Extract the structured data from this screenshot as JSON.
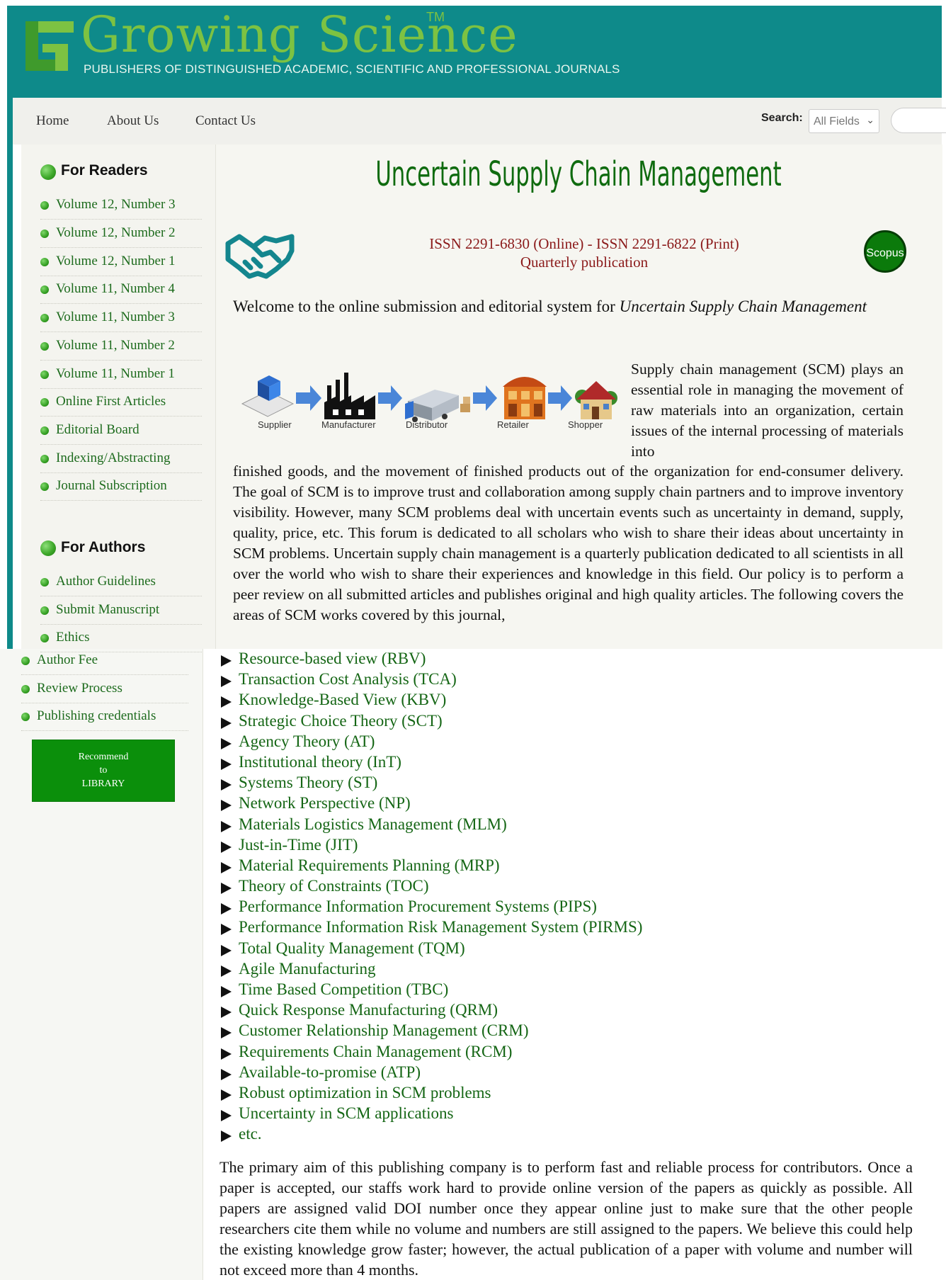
{
  "header": {
    "brand": "Growing Science",
    "trademark": "TM",
    "tagline": "PUBLISHERS OF DISTINGUISHED ACADEMIC, SCIENTIFIC AND PROFESSIONAL JOURNALS",
    "colors": {
      "header_bg": "#0e8a8a",
      "brand_green": "#7dc242"
    }
  },
  "nav": {
    "links": [
      "Home",
      "About Us",
      "Contact Us"
    ],
    "search_label": "Search:",
    "search_scope": "All Fields",
    "search_placeholder": ""
  },
  "sidebar": {
    "readers_heading": "For Readers",
    "readers": [
      "Volume 12, Number 3",
      "Volume 12, Number 2",
      "Volume 12, Number 1",
      "Volume 11, Number 4",
      "Volume 11, Number 3",
      "Volume 11, Number 2",
      "Volume 11, Number 1",
      "Online First Articles",
      "Editorial Board",
      "Indexing/Abstracting",
      "Journal Subscription"
    ],
    "authors_heading": "For Authors",
    "authors": [
      "Author Guidelines",
      "Submit Manuscript",
      "Ethics",
      "Author Fee",
      "Review Process",
      "Publishing credentials"
    ],
    "library_button": [
      "Recommend",
      "to",
      "LIBRARY"
    ]
  },
  "main": {
    "title": "Uncertain Supply Chain Management",
    "issn": "ISSN 2291-6830 (Online) - ISSN 2291-6822 (Print)",
    "frequency": "Quarterly publication",
    "scopus_badge": "Scopus",
    "welcome_prefix": "Welcome to the online submission and editorial system for ",
    "welcome_journal": "Uncertain Supply Chain Management",
    "chain_labels": [
      "Supplier",
      "Manufacturer",
      "Distributor",
      "Retailer",
      "Shopper"
    ],
    "intro_part1": "Supply chain management (SCM) plays an essential role in managing the movement of raw materials into an organization, certain issues of the internal processing of materials into",
    "intro_part2": "finished goods, and the movement of finished products out of the organization for end-consumer delivery. The goal of SCM is to improve trust and collaboration among supply chain partners and to improve inventory visibility. However, many SCM problems deal with uncertain events such as uncertainty in demand, supply, quality, price, etc. This forum is dedicated to all scholars who wish to share their ideas about uncertainty in SCM problems. Uncertain supply chain management is a quarterly publication dedicated to all scientists in all over the world who wish to share their experiences and knowledge in this field. Our policy is to perform a peer review on all submitted articles and publishes original and high quality articles. The following covers the areas of SCM works covered by this journal,",
    "topics": [
      "Resource-based view (RBV)",
      "Transaction Cost Analysis (TCA)",
      "Knowledge-Based View (KBV)",
      "Strategic Choice Theory (SCT)",
      "Agency Theory (AT)",
      "Institutional theory (InT)",
      "Systems Theory (ST)",
      "Network Perspective (NP)",
      "Materials Logistics Management (MLM)",
      "Just-in-Time (JIT)",
      "Material Requirements Planning (MRP)",
      "Theory of Constraints (TOC)",
      "Performance Information Procurement Systems (PIPS)",
      "Performance Information Risk Management System (PIRMS)",
      "Total Quality Management (TQM)",
      "Agile Manufacturing",
      "Time Based Competition (TBC)",
      "Quick Response Manufacturing (QRM)",
      "Customer Relationship Management (CRM)",
      "Requirements Chain Management (RCM)",
      "Available-to-promise (ATP)",
      "Robust optimization in SCM problems",
      "Uncertainty in SCM applications",
      "etc."
    ],
    "primary_aim": "The primary aim of this publishing company is to perform fast and reliable process for contributors. Once a paper is accepted, our staffs work hard to provide online version of the papers as quickly as possible. All papers are assigned valid DOI number once they appear online just to make sure that the other people researchers cite them while no volume and numbers are still assigned to the papers. We believe this could help the existing knowledge grow faster; however, the actual publication of a paper with volume and number will not exceed more than 4 months."
  }
}
